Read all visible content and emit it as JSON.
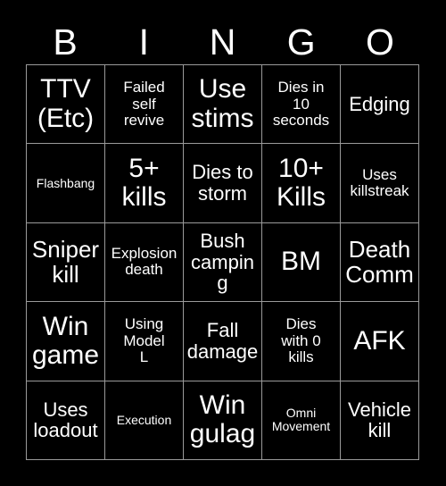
{
  "card": {
    "title": "BINGO",
    "background_color": "#000000",
    "text_color": "#ffffff",
    "grid_line_color": "#9a9a9a",
    "columns": 5,
    "rows": 5,
    "header_letters": [
      "B",
      "I",
      "N",
      "G",
      "O"
    ],
    "cells": [
      [
        {
          "text": "TTV\n(Etc)",
          "size": "xl",
          "marked": false
        },
        {
          "text": "Failed\nself\nrevive",
          "size": "sm",
          "marked": false
        },
        {
          "text": "Use\nstims",
          "size": "xl",
          "marked": false
        },
        {
          "text": "Dies in\n10\nseconds",
          "size": "sm",
          "marked": false
        },
        {
          "text": "Edging",
          "size": "md",
          "marked": false
        }
      ],
      [
        {
          "text": "Flashbang",
          "size": "xs",
          "marked": false
        },
        {
          "text": "5+\nkills",
          "size": "xl",
          "marked": false
        },
        {
          "text": "Dies to\nstorm",
          "size": "md",
          "marked": false
        },
        {
          "text": "10+\nKills",
          "size": "xl",
          "marked": false
        },
        {
          "text": "Uses\nkillstreak",
          "size": "sm",
          "marked": false
        }
      ],
      [
        {
          "text": "Sniper\nkill",
          "size": "lg",
          "marked": false
        },
        {
          "text": "Explosion\ndeath",
          "size": "sm",
          "marked": false
        },
        {
          "text": "Bush\ncamping",
          "size": "md",
          "marked": false
        },
        {
          "text": "BM",
          "size": "xl",
          "marked": false
        },
        {
          "text": "Death\nComm",
          "size": "lg",
          "marked": false
        }
      ],
      [
        {
          "text": "Win\ngame",
          "size": "xl",
          "marked": false
        },
        {
          "text": "Using\nModel\nL",
          "size": "sm",
          "marked": false
        },
        {
          "text": "Fall\ndamage",
          "size": "md",
          "marked": false
        },
        {
          "text": "Dies\nwith 0\nkills",
          "size": "sm",
          "marked": false
        },
        {
          "text": "AFK",
          "size": "xl",
          "marked": false
        }
      ],
      [
        {
          "text": "Uses\nloadout",
          "size": "md",
          "marked": false
        },
        {
          "text": "Execution",
          "size": "xs",
          "marked": false
        },
        {
          "text": "Win\ngulag",
          "size": "xl",
          "marked": false
        },
        {
          "text": "Omni\nMovement",
          "size": "xs",
          "marked": false
        },
        {
          "text": "Vehicle\nkill",
          "size": "md",
          "marked": false
        }
      ]
    ]
  }
}
